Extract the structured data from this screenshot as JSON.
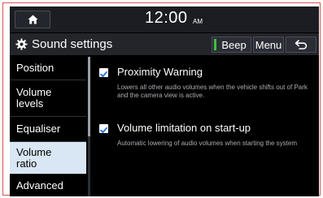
{
  "status_bar": {
    "time": "12:00",
    "ampm": "AM"
  },
  "title_bar": {
    "title": "Sound settings",
    "beep_label": "Beep",
    "menu_label": "Menu"
  },
  "sidebar": {
    "items": [
      {
        "label": "Position"
      },
      {
        "label": "Volume levels"
      },
      {
        "label": "Equaliser"
      },
      {
        "label": "Volume ratio"
      },
      {
        "label": "Advanced"
      }
    ],
    "active_index": 3
  },
  "options": [
    {
      "title": "Proximity Warning",
      "description": "Lowers all other audio volumes when the vehicle shifts out of Park and the camera view is active.",
      "checked": true
    },
    {
      "title": "Volume limitation on start-up",
      "description": "Automatic lowering of audio volumes when starting the system",
      "checked": true
    }
  ],
  "colors": {
    "screen_bg": "#000000",
    "active_item_bg": "#d9e6f3",
    "beep_indicator": "#3fbf3f",
    "frame_border": "#d9534f"
  },
  "icons": {
    "home": "home-icon",
    "settings": "gear-icon",
    "back": "back-arrow-icon",
    "check": "check-icon"
  }
}
